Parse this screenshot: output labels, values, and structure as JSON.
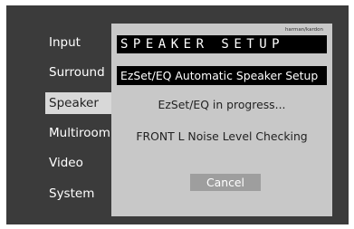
{
  "menu": {
    "items": [
      {
        "label": "Input"
      },
      {
        "label": "Surround"
      },
      {
        "label": "Speaker"
      },
      {
        "label": "Multiroom"
      },
      {
        "label": "Video"
      },
      {
        "label": "System"
      }
    ],
    "selected": "Speaker"
  },
  "dialog": {
    "brand": "harman/kardon",
    "title": "SPEAKER SETUP",
    "subtitle": "EzSet/EQ Automatic Speaker Setup",
    "status_line1": "EzSet/EQ in progress...",
    "status_line2": "FRONT L Noise Level Checking",
    "cancel_label": "Cancel"
  },
  "colors": {
    "screen_bg": "#3b3b3b",
    "panel_bg": "#c8c8c8",
    "selected_bg": "#d8d8d8",
    "bar_bg": "#000000",
    "button_bg": "#9e9e9e"
  }
}
